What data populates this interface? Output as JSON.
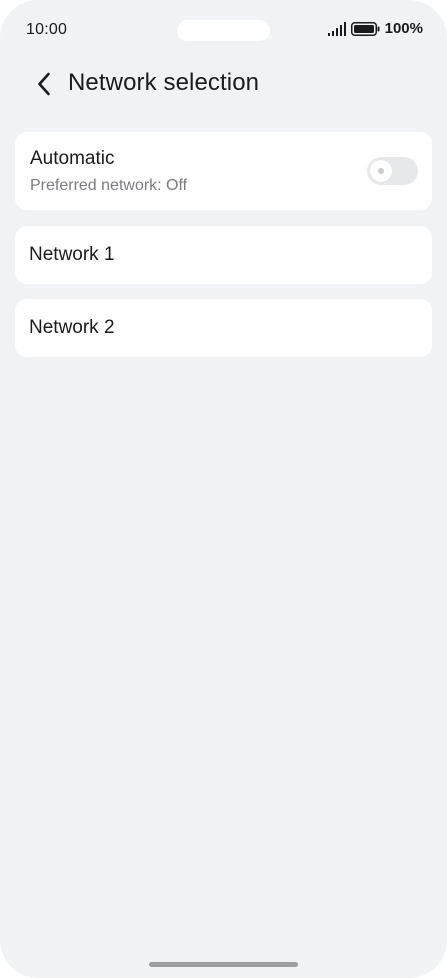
{
  "status_bar": {
    "time": "10:00",
    "battery_percent": "100%",
    "signal_icon": "signal-bars-icon",
    "battery_icon": "battery-full-icon"
  },
  "header": {
    "back_icon": "chevron-left-icon",
    "title": "Network selection"
  },
  "automatic": {
    "title": "Automatic",
    "subtitle": "Preferred network: Off",
    "toggle_on": false
  },
  "networks": [
    {
      "label": "Network 1"
    },
    {
      "label": "Network 2"
    }
  ],
  "colors": {
    "background": "#f1f2f4",
    "card": "#ffffff",
    "text_primary": "#1b1b1d",
    "text_secondary": "#7b7c80",
    "toggle_off_track": "#e7e8ea"
  }
}
